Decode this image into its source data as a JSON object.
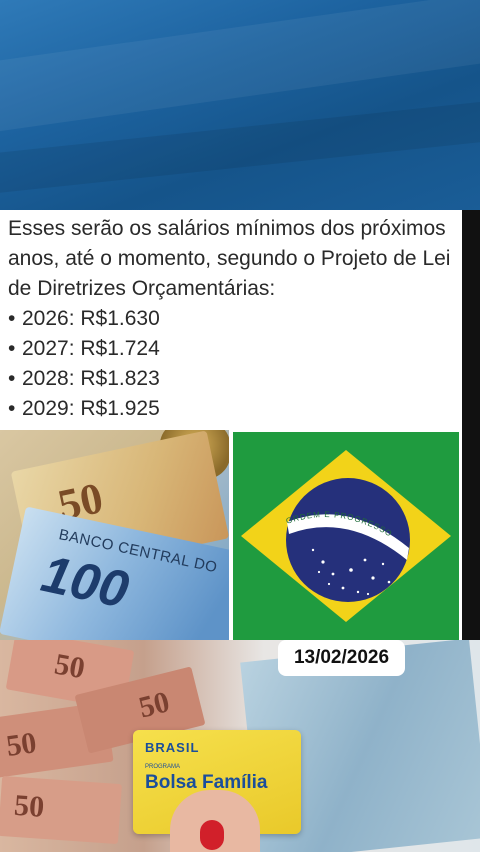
{
  "post": {
    "intro": "Esses serão os salários mínimos dos próximos anos, até o momento, segundo o Projeto de Lei de Diretrizes Orçamentárias:",
    "items": [
      {
        "bullet": "•",
        "text": "2026: R$1.630"
      },
      {
        "bullet": "•",
        "text": "2027: R$1.724"
      },
      {
        "bullet": "•",
        "text": "2028: R$1.823"
      },
      {
        "bullet": "•",
        "text": "2029: R$1.925"
      }
    ]
  },
  "images": {
    "money_note_50": "50",
    "money_note_100": "100",
    "money_bank_text": "BANCO CENTRAL DO",
    "flag_motto": "ORDEM E PROGRESSO",
    "bottom_notes": [
      "50",
      "50",
      "50",
      "50"
    ],
    "card_brand": "BRASIL",
    "card_program": "PROGRAMA",
    "card_title": "Bolsa Família"
  },
  "date_badge": "13/02/2026",
  "colors": {
    "flag_green": "#1f9b3f",
    "flag_yellow": "#f2d319",
    "flag_blue": "#25307b",
    "card_yellow": "#f2d63a"
  }
}
